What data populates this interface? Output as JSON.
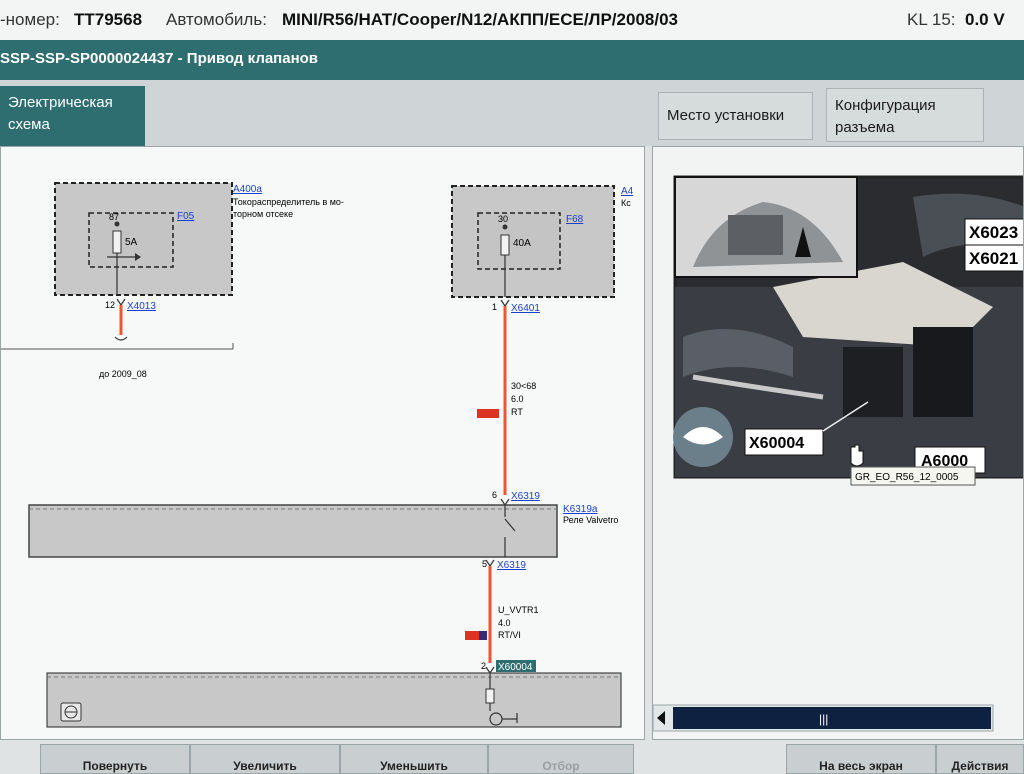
{
  "header": {
    "vin_label": "-номер:",
    "vin_value": "TT79568",
    "vehicle_label": "Автомобиль:",
    "vehicle_value": "MINI/R56/HAT/Cooper/N12/АКПП/ECE/ЛР/2008/03",
    "kl_label": "KL 15:",
    "kl_value": "0.0 V"
  },
  "title": "SSP-SSP-SP0000024437  -  Привод клапанов",
  "tabs": {
    "schematic": "Электрическая схема",
    "location": "Место установки",
    "connector": "Конфигурация разъема"
  },
  "diagram": {
    "left_box": {
      "component_id": "A400a",
      "component_desc_1": "Токораспределитель в мо-",
      "component_desc_2": "торном отсеке",
      "pin_top": "87",
      "fuse_id": "F05",
      "fuse_rating": "5A",
      "pin_bottom": "12",
      "connector": "X4013",
      "note": "до 2009_08"
    },
    "right_box": {
      "component_id": "A4",
      "component_desc": "Кс",
      "pin_top": "30",
      "fuse_id": "F68",
      "fuse_rating": "40A",
      "pin_bottom": "1",
      "connector": "X6401"
    },
    "wire_1": {
      "line1": "30<68",
      "line2": "6.0",
      "line3": "RT"
    },
    "relay": {
      "pin_top": "6",
      "connector_top": "X6319",
      "id": "K6319a",
      "desc": "Реле Valvetro",
      "pin_bottom": "5",
      "connector_bottom": "X6319"
    },
    "wire_2": {
      "line1": "U_VVTR1",
      "line2": "4.0",
      "line3": "RT/VI"
    },
    "bottom": {
      "pin": "2",
      "connector": "X60004"
    }
  },
  "photo": {
    "callouts": [
      "X6023",
      "X6021",
      "X60004",
      "A6000"
    ],
    "caption": "GR_EO_R56_12_0005"
  },
  "buttons": {
    "b1": "Повернуть",
    "b2": "Увеличить",
    "b3": "Уменьшить",
    "b4": "Отбор",
    "b5": "На весь экран",
    "b6": "Действия"
  },
  "colors": {
    "accent": "#2e6e70",
    "wire_red": "#ee5533",
    "link_blue": "#1a3fd0"
  }
}
